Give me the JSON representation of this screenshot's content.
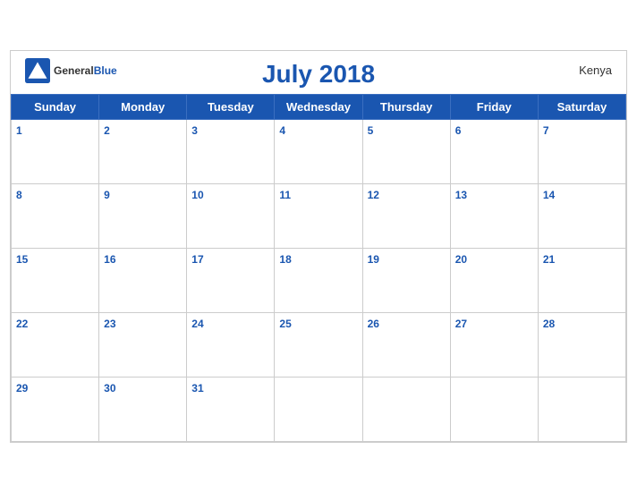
{
  "header": {
    "title": "July 2018",
    "country": "Kenya",
    "logo": {
      "general": "General",
      "blue": "Blue"
    }
  },
  "days": [
    "Sunday",
    "Monday",
    "Tuesday",
    "Wednesday",
    "Thursday",
    "Friday",
    "Saturday"
  ],
  "weeks": [
    [
      1,
      2,
      3,
      4,
      5,
      6,
      7
    ],
    [
      8,
      9,
      10,
      11,
      12,
      13,
      14
    ],
    [
      15,
      16,
      17,
      18,
      19,
      20,
      21
    ],
    [
      22,
      23,
      24,
      25,
      26,
      27,
      28
    ],
    [
      29,
      30,
      31,
      null,
      null,
      null,
      null
    ]
  ]
}
